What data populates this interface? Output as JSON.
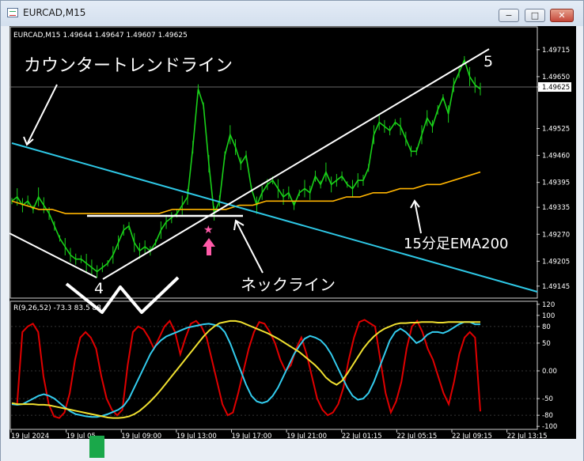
{
  "window": {
    "title": "EURCAD,M15",
    "buttons": [
      "minimize-button",
      "maximize-button",
      "close-button"
    ]
  },
  "chart_data": [
    {
      "type": "line",
      "header": "EURCAD,M15  1.49644 1.49647 1.49607 1.49625",
      "y_ticks": [
        "1.49715",
        "1.49650",
        "1.49625",
        "1.49525",
        "1.49460",
        "1.49395",
        "1.49335",
        "1.49270",
        "1.49205",
        "1.49145"
      ],
      "current_price": 1.49625,
      "ylim": [
        1.49118,
        1.49768
      ],
      "series": [
        {
          "color": "#19d119",
          "values": [
            1.4935,
            1.4936,
            1.4934,
            1.4935,
            1.4933,
            1.4936,
            1.4934,
            1.4932,
            1.4929,
            1.4926,
            1.4924,
            1.4922,
            1.4921,
            1.4921,
            1.492,
            1.4919,
            1.4918,
            1.4919,
            1.492,
            1.4922,
            1.4925,
            1.4928,
            1.4929,
            1.4925,
            1.4923,
            1.4924,
            1.4923,
            1.4925,
            1.4928,
            1.493,
            1.4931,
            1.4932,
            1.4934,
            1.4936,
            1.4948,
            1.4962,
            1.4958,
            1.4944,
            1.4932,
            1.4935,
            1.4946,
            1.4951,
            1.4948,
            1.4944,
            1.4946,
            1.4938,
            1.4934,
            1.4937,
            1.4939,
            1.494,
            1.4938,
            1.4936,
            1.4937,
            1.4934,
            1.4937,
            1.4938,
            1.4937,
            1.4941,
            1.4939,
            1.4942,
            1.4939,
            1.494,
            1.4941,
            1.4939,
            1.4938,
            1.494,
            1.494,
            1.4943,
            1.4951,
            1.4954,
            1.4953,
            1.4952,
            1.4954,
            1.4953,
            1.495,
            1.4947,
            1.4947,
            1.4951,
            1.4955,
            1.4953,
            1.4957,
            1.496,
            1.4956,
            1.4963,
            1.4966,
            1.4969,
            1.4965,
            1.4963,
            1.4962
          ]
        },
        {
          "name": "15分足EMA200",
          "color": "#ffb400",
          "values": [
            1.4935,
            1.4934,
            1.4933,
            1.4933,
            1.4932,
            1.4932,
            1.4932,
            1.4932,
            1.4932,
            1.4932,
            1.4932,
            1.4932,
            1.4933,
            1.4933,
            1.4933,
            1.4933,
            1.4933,
            1.4934,
            1.4934,
            1.4935,
            1.4935,
            1.4935,
            1.4935,
            1.4935,
            1.4935,
            1.4936,
            1.4936,
            1.4937,
            1.4937,
            1.4938,
            1.4938,
            1.4939,
            1.4939,
            1.494,
            1.4941,
            1.4942
          ]
        }
      ],
      "annotations": [
        {
          "label": "カウンタートレンドライン",
          "color": "#ffffff"
        },
        {
          "label": "ネックライン",
          "color": "#ffffff"
        },
        {
          "label": "15分足EMA200",
          "color": "#ffffff"
        },
        {
          "label": "4",
          "color": "#ffffff"
        },
        {
          "label": "5",
          "color": "#ffffff"
        }
      ]
    },
    {
      "type": "line",
      "header": "R(9,26,52) -73.3 83.5 88.",
      "y_ticks": [
        "120",
        "100",
        "80",
        "50",
        "0.00",
        "-50",
        "-80",
        "-100"
      ],
      "ylim": [
        -104,
        124
      ],
      "series": [
        {
          "color": "#e00000",
          "values": [
            -60,
            -60,
            70,
            80,
            85,
            70,
            -10,
            -60,
            -82,
            -85,
            -75,
            -40,
            20,
            60,
            70,
            60,
            40,
            -10,
            -50,
            -70,
            -80,
            -70,
            10,
            70,
            80,
            75,
            60,
            40,
            60,
            80,
            90,
            70,
            30,
            60,
            85,
            90,
            80,
            60,
            20,
            -20,
            -60,
            -80,
            -75,
            -40,
            0,
            40,
            70,
            88,
            85,
            70,
            50,
            20,
            0,
            10,
            40,
            60,
            30,
            -10,
            -50,
            -70,
            -80,
            -75,
            -60,
            -30,
            20,
            60,
            88,
            92,
            86,
            80,
            20,
            -40,
            -75,
            -55,
            -20,
            40,
            80,
            90,
            70,
            40,
            20,
            -10,
            -40,
            -60,
            -20,
            30,
            60,
            70,
            60,
            -73
          ]
        },
        {
          "color": "#33ccee",
          "values": [
            -60,
            -61,
            -60,
            -55,
            -50,
            -45,
            -42,
            -45,
            -50,
            -58,
            -66,
            -73,
            -78,
            -80,
            -82,
            -83,
            -83,
            -81,
            -78,
            -74,
            -70,
            -63,
            -50,
            -30,
            -10,
            10,
            30,
            45,
            55,
            62,
            66,
            70,
            74,
            78,
            80,
            82,
            84,
            85,
            83,
            80,
            70,
            50,
            25,
            0,
            -25,
            -45,
            -55,
            -58,
            -55,
            -45,
            -30,
            -10,
            10,
            30,
            45,
            58,
            63,
            60,
            55,
            45,
            30,
            10,
            -10,
            -30,
            -45,
            -52,
            -50,
            -40,
            -20,
            5,
            30,
            55,
            70,
            76,
            70,
            60,
            50,
            55,
            65,
            70,
            70,
            68,
            72,
            78,
            84,
            88,
            88,
            84,
            84
          ]
        },
        {
          "color": "#f0e030",
          "values": [
            -58,
            -60,
            -60,
            -60,
            -60,
            -61,
            -61,
            -62,
            -64,
            -66,
            -68,
            -70,
            -72,
            -74,
            -76,
            -78,
            -80,
            -82,
            -84,
            -85,
            -85,
            -84,
            -82,
            -78,
            -72,
            -64,
            -55,
            -45,
            -34,
            -22,
            -10,
            2,
            14,
            26,
            38,
            50,
            62,
            72,
            80,
            86,
            88,
            90,
            90,
            88,
            84,
            80,
            76,
            72,
            68,
            63,
            58,
            52,
            46,
            40,
            34,
            26,
            18,
            10,
            0,
            -12,
            -20,
            -25,
            -18,
            -5,
            10,
            25,
            40,
            52,
            62,
            70,
            76,
            80,
            84,
            86,
            86,
            87,
            87,
            88,
            88,
            88,
            87,
            87,
            88,
            88,
            88,
            88,
            88,
            88,
            88
          ]
        }
      ]
    }
  ],
  "x_ticks": [
    "19 Jul 2024",
    "19 Jul 05",
    "19 Jul 09:00",
    "19 Jul 13:00",
    "19 Jul 17:00",
    "19 Jul 21:00",
    "22 Jul 01:15",
    "22 Jul 05:15",
    "22 Jul 09:15",
    "22 Jul 13:15"
  ]
}
